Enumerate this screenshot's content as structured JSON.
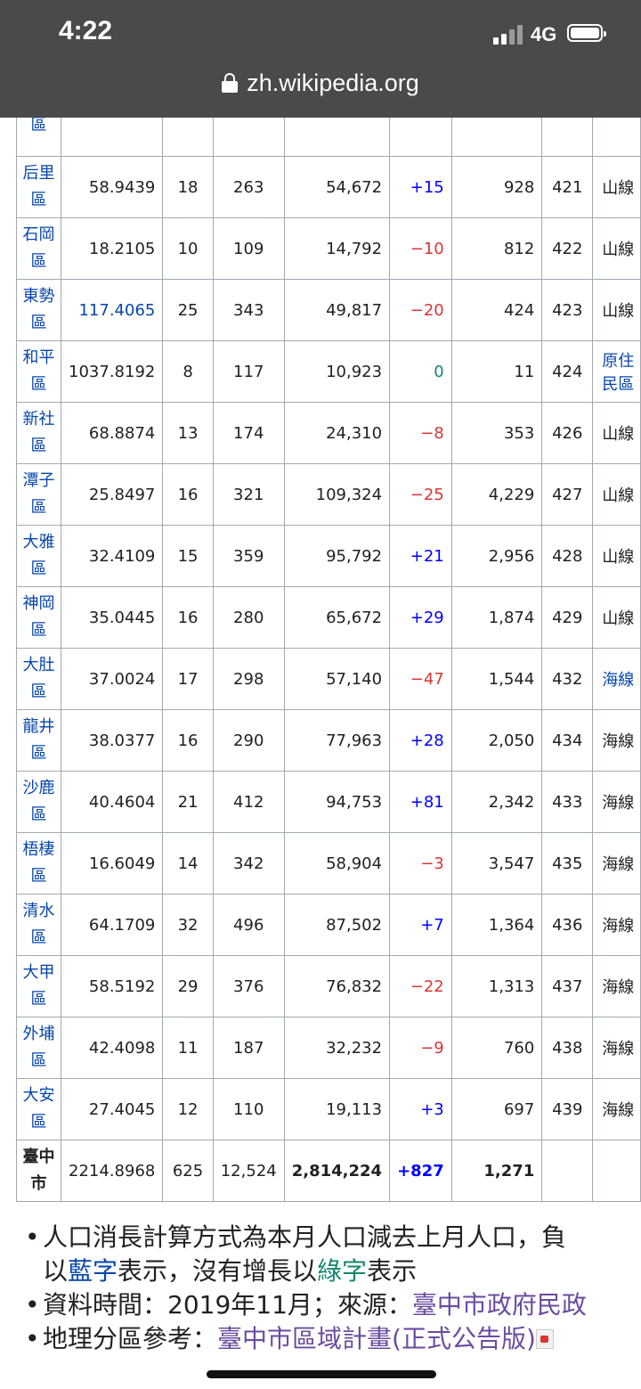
{
  "status": {
    "time": "4:22",
    "network": "4G",
    "battery_level": 1.0
  },
  "browser": {
    "url": "zh.wikipedia.org"
  },
  "rows": [
    {
      "name": "區",
      "area": "",
      "villages": "",
      "neighborhoods": "",
      "population": "",
      "change": "",
      "density": "",
      "postal": "",
      "region": ""
    },
    {
      "name": "后里區",
      "area": "58.9439",
      "villages": "18",
      "neighborhoods": "263",
      "population": "54,672",
      "change": "+15",
      "density": "928",
      "postal": "421",
      "region": "山線"
    },
    {
      "name": "石岡區",
      "area": "18.2105",
      "villages": "10",
      "neighborhoods": "109",
      "population": "14,792",
      "change": "−10",
      "density": "812",
      "postal": "422",
      "region": "山線"
    },
    {
      "name": "東勢區",
      "area": "117.4065",
      "villages": "25",
      "neighborhoods": "343",
      "population": "49,817",
      "change": "−20",
      "density": "424",
      "postal": "423",
      "region": "山線"
    },
    {
      "name": "和平區",
      "area": "1037.8192",
      "villages": "8",
      "neighborhoods": "117",
      "population": "10,923",
      "change": "0",
      "density": "11",
      "postal": "424",
      "region": "原住民區"
    },
    {
      "name": "新社區",
      "area": "68.8874",
      "villages": "13",
      "neighborhoods": "174",
      "population": "24,310",
      "change": "−8",
      "density": "353",
      "postal": "426",
      "region": "山線"
    },
    {
      "name": "潭子區",
      "area": "25.8497",
      "villages": "16",
      "neighborhoods": "321",
      "population": "109,324",
      "change": "−25",
      "density": "4,229",
      "postal": "427",
      "region": "山線"
    },
    {
      "name": "大雅區",
      "area": "32.4109",
      "villages": "15",
      "neighborhoods": "359",
      "population": "95,792",
      "change": "+21",
      "density": "2,956",
      "postal": "428",
      "region": "山線"
    },
    {
      "name": "神岡區",
      "area": "35.0445",
      "villages": "16",
      "neighborhoods": "280",
      "population": "65,672",
      "change": "+29",
      "density": "1,874",
      "postal": "429",
      "region": "山線"
    },
    {
      "name": "大肚區",
      "area": "37.0024",
      "villages": "17",
      "neighborhoods": "298",
      "population": "57,140",
      "change": "−47",
      "density": "1,544",
      "postal": "432",
      "region": "海線"
    },
    {
      "name": "龍井區",
      "area": "38.0377",
      "villages": "16",
      "neighborhoods": "290",
      "population": "77,963",
      "change": "+28",
      "density": "2,050",
      "postal": "434",
      "region": "海線"
    },
    {
      "name": "沙鹿區",
      "area": "40.4604",
      "villages": "21",
      "neighborhoods": "412",
      "population": "94,753",
      "change": "+81",
      "density": "2,342",
      "postal": "433",
      "region": "海線"
    },
    {
      "name": "梧棲區",
      "area": "16.6049",
      "villages": "14",
      "neighborhoods": "342",
      "population": "58,904",
      "change": "−3",
      "density": "3,547",
      "postal": "435",
      "region": "海線"
    },
    {
      "name": "清水區",
      "area": "64.1709",
      "villages": "32",
      "neighborhoods": "496",
      "population": "87,502",
      "change": "+7",
      "density": "1,364",
      "postal": "436",
      "region": "海線"
    },
    {
      "name": "大甲區",
      "area": "58.5192",
      "villages": "29",
      "neighborhoods": "376",
      "population": "76,832",
      "change": "−22",
      "density": "1,313",
      "postal": "437",
      "region": "海線"
    },
    {
      "name": "外埔區",
      "area": "42.4098",
      "villages": "11",
      "neighborhoods": "187",
      "population": "32,232",
      "change": "−9",
      "density": "760",
      "postal": "438",
      "region": "海線"
    },
    {
      "name": "大安區",
      "area": "27.4045",
      "villages": "12",
      "neighborhoods": "110",
      "population": "19,113",
      "change": "+3",
      "density": "697",
      "postal": "439",
      "region": "海線"
    }
  ],
  "total": {
    "name": "臺中市",
    "area": "2214.8968",
    "villages": "625",
    "neighborhoods": "12,524",
    "population": "2,814,224",
    "change": "+827",
    "density": "1,271"
  },
  "notes": {
    "n1_a": "人口消長計算方式為本月人口減去上月人口，負",
    "n1_b": "以",
    "n1_blue": "藍字",
    "n1_c": "表示，沒有增長以",
    "n1_green": "綠字",
    "n1_d": "表示",
    "n2_a": "資料時間：2019年11月；來源：",
    "n2_link": "臺中市政府民政",
    "n3_a": "地理分區參考：",
    "n3_link": "臺中市區域計畫(正式公告版)"
  }
}
